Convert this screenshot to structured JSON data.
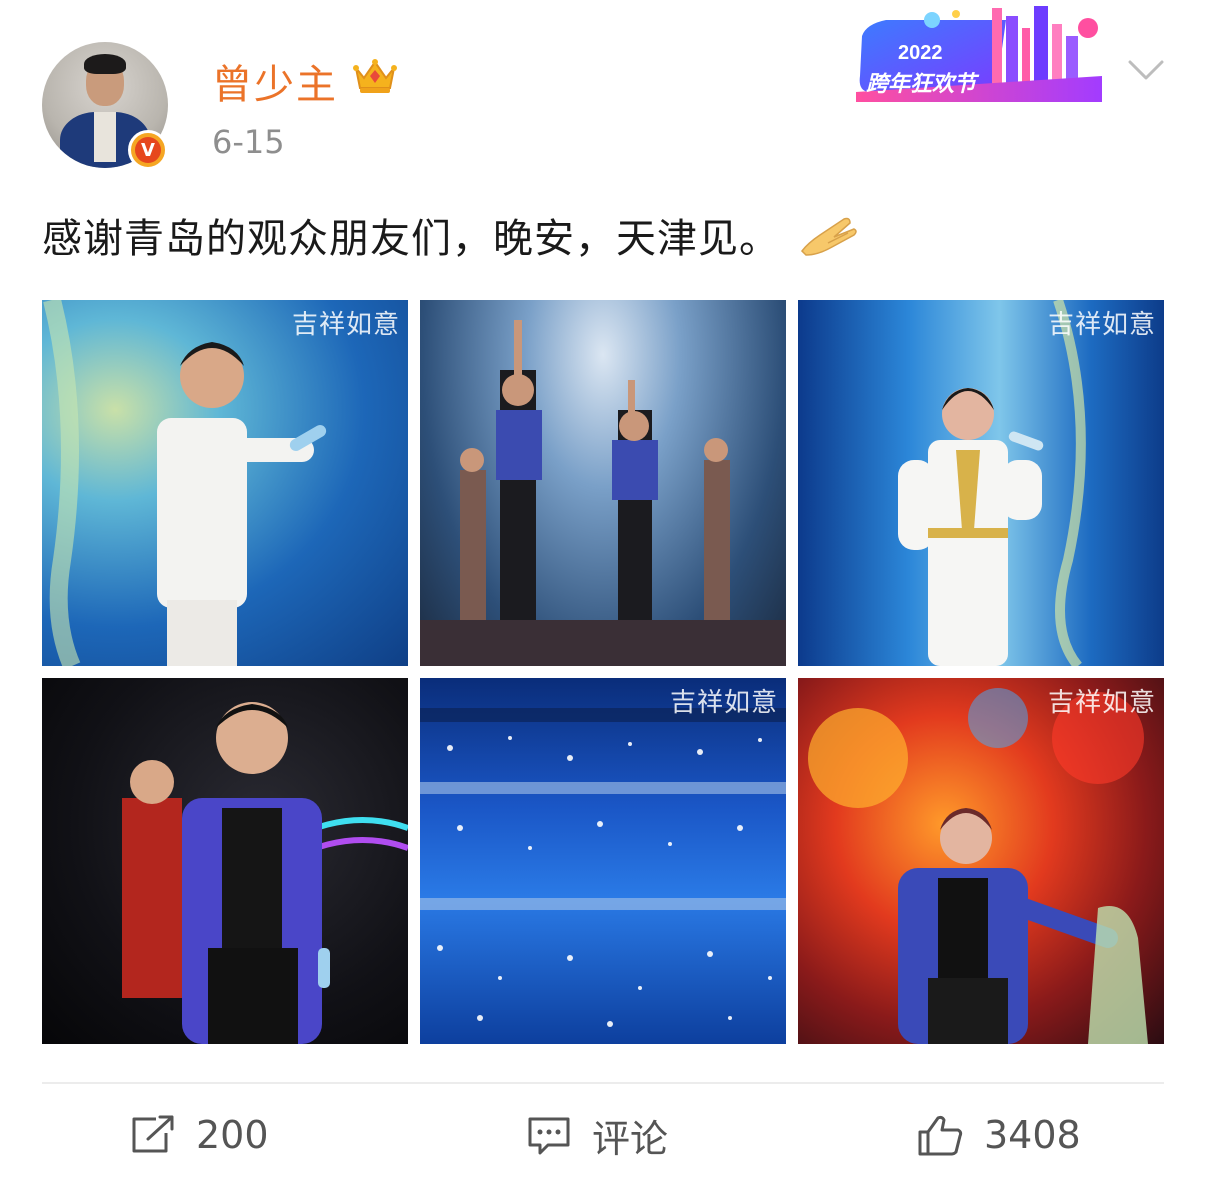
{
  "post": {
    "username": "曾少主",
    "date": "6-15",
    "text": "感谢青岛的观众朋友们，晚安，天津见。",
    "emoji": "palms-together-icon",
    "verified_badge": "V"
  },
  "promo_banner": {
    "year": "2022",
    "title": "跨年狂欢节"
  },
  "photos": [
    {
      "watermark": "吉祥如意",
      "subject": "male singer in white suit with microphone"
    },
    {
      "watermark": "",
      "subject": "performers on stage with raised arms"
    },
    {
      "watermark": "吉祥如意",
      "subject": "female singer in white outfit"
    },
    {
      "watermark": "",
      "subject": "smiling man in sparkly blue jacket"
    },
    {
      "watermark": "吉祥如意",
      "subject": "stadium audience with blue light sticks"
    },
    {
      "watermark": "吉祥如意",
      "subject": "singer in blue jacket on colorful stage"
    }
  ],
  "actions": {
    "repost_count": "200",
    "comment_label": "评论",
    "like_count": "3408"
  },
  "colors": {
    "username": "#eb7329",
    "date": "#8e8e8e",
    "action_text": "#555555"
  }
}
